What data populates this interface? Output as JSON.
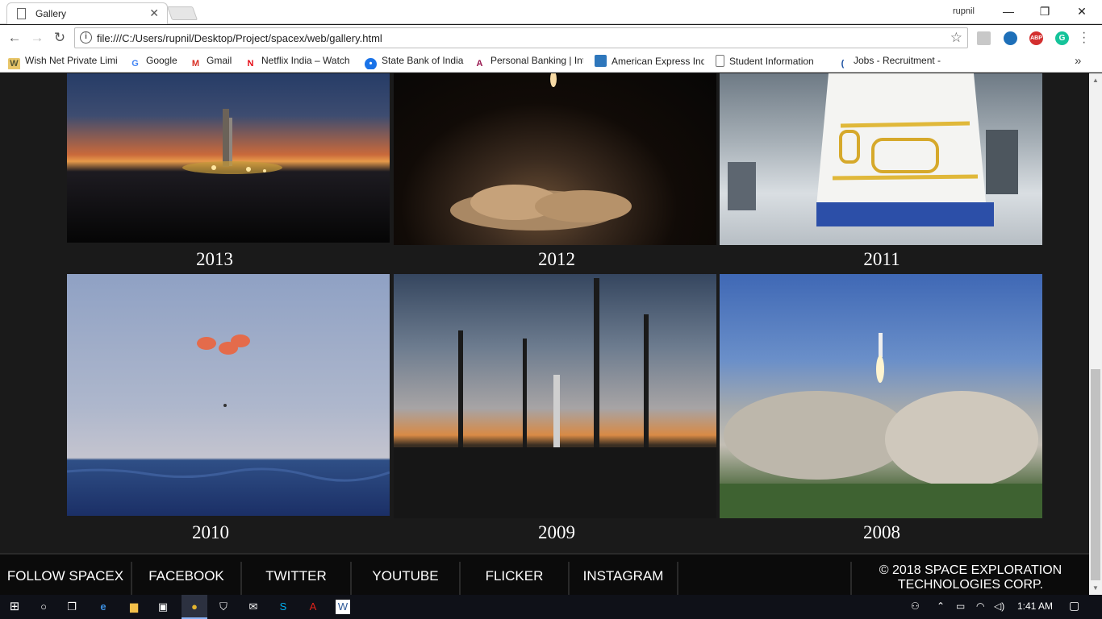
{
  "browser": {
    "tab_title": "Gallery",
    "tab_close": "✕",
    "user_name": "rupnil",
    "url": "file:///C:/Users/rupnil/Desktop/Project/spacex/web/gallery.html",
    "bookmarks": [
      {
        "label": "Wish Net Private Limi",
        "icon": "wishnet-icon"
      },
      {
        "label": "Google",
        "icon": "google-icon"
      },
      {
        "label": "Gmail",
        "icon": "gmail-icon"
      },
      {
        "label": "Netflix India – Watch",
        "icon": "netflix-icon"
      },
      {
        "label": "State Bank of India",
        "icon": "sbi-icon"
      },
      {
        "label": "Personal Banking | Int",
        "icon": "axis-bank-icon"
      },
      {
        "label": "American Express Ind",
        "icon": "amex-icon"
      },
      {
        "label": "Student Information",
        "icon": "page-icon"
      },
      {
        "label": "Jobs - Recruitment -",
        "icon": "jobs-icon"
      }
    ],
    "extensions": [
      "ext-page-icon",
      "ext-circle-icon",
      "adblock-plus-icon",
      "grammarly-icon"
    ],
    "ext_labels": {
      "abp": "ABP",
      "grammarly": "G"
    }
  },
  "gallery": {
    "items": [
      {
        "year": "2013",
        "scene": "rocket-launchpad-sunset"
      },
      {
        "year": "2012",
        "scene": "night-launch-smoke"
      },
      {
        "year": "2011",
        "scene": "capsule-in-factory"
      },
      {
        "year": "2010",
        "scene": "capsule-parachutes-ocean"
      },
      {
        "year": "2009",
        "scene": "launch-towers-sunset"
      },
      {
        "year": "2008",
        "scene": "rocket-launch-daytime"
      }
    ]
  },
  "footer": {
    "links": [
      "FOLLOW SPACEX",
      "FACEBOOK",
      "TWITTER",
      "YOUTUBE",
      "FLICKER",
      "INSTAGRAM"
    ],
    "copyright_line1": "© 2018 SPACE EXPLORATION",
    "copyright_line2": "TECHNOLOGIES CORP."
  },
  "taskbar": {
    "time": "1:41 AM",
    "pinned": [
      "edge-icon",
      "file-explorer-icon",
      "store-icon",
      "chrome-icon",
      "defender-icon",
      "mail-icon",
      "skype-icon",
      "acrobat-icon",
      "word-icon"
    ]
  },
  "colors": {
    "page_bg": "#1a1a1a",
    "footer_bg": "#0b0b0b",
    "text": "#ffffff"
  }
}
